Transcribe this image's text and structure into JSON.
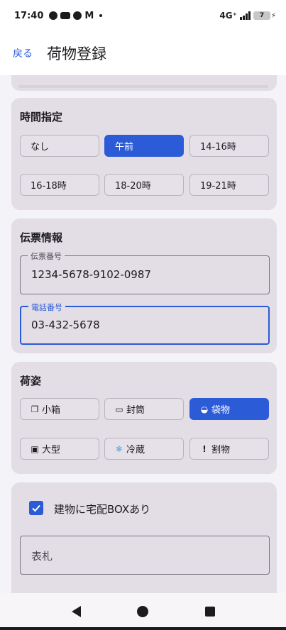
{
  "status": {
    "time": "17:40",
    "network": "4G⁺",
    "battery": "7"
  },
  "appbar": {
    "back_label": "戻る",
    "title": "荷物登録"
  },
  "time_section": {
    "title": "時間指定",
    "options": [
      {
        "label": "なし",
        "selected": false
      },
      {
        "label": "午前",
        "selected": true
      },
      {
        "label": "14-16時",
        "selected": false
      },
      {
        "label": "16-18時",
        "selected": false
      },
      {
        "label": "18-20時",
        "selected": false
      },
      {
        "label": "19-21時",
        "selected": false
      }
    ]
  },
  "slip_section": {
    "title": "伝票情報",
    "slip_number": {
      "label": "伝票番号",
      "value": "1234-5678-9102-0987"
    },
    "phone": {
      "label": "電話番号",
      "value": "03-432-5678"
    }
  },
  "package_section": {
    "title": "荷姿",
    "options": [
      {
        "label": "小箱",
        "icon": "box-icon",
        "glyph": "❐",
        "selected": false
      },
      {
        "label": "封筒",
        "icon": "envelope-icon",
        "glyph": "▭",
        "selected": false
      },
      {
        "label": "袋物",
        "icon": "bag-icon",
        "glyph": "◒",
        "selected": true
      },
      {
        "label": "大型",
        "icon": "large-icon",
        "glyph": "▣",
        "selected": false
      },
      {
        "label": "冷蔵",
        "icon": "snowflake-icon",
        "glyph": "❄",
        "selected": false
      },
      {
        "label": "割物",
        "icon": "fragile-icon",
        "glyph": "!",
        "selected": false
      }
    ]
  },
  "box_section": {
    "checkbox_label": "建物に宅配BOXあり",
    "checked": true,
    "nameplate_placeholder": "表札"
  },
  "colors": {
    "accent": "#2b5bd6",
    "card": "#e3dde6",
    "background": "#f4f3f7"
  }
}
